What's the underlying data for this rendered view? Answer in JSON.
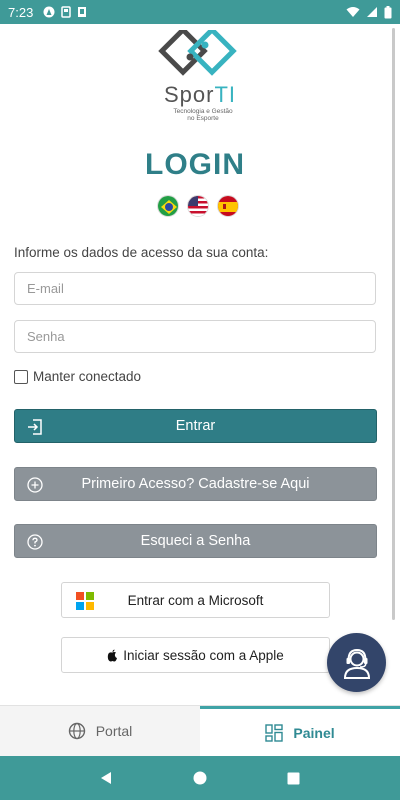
{
  "status_bar": {
    "time": "7:23"
  },
  "logo": {
    "word_main": "Spor",
    "word_accent": "TI",
    "tagline_line1": "Tecnologia e Gestão",
    "tagline_line2": "no Esporte"
  },
  "title": "LOGIN",
  "languages": [
    "brazil-flag",
    "usa-flag",
    "spain-flag"
  ],
  "instruction": "Informe os dados de acesso da sua conta:",
  "form": {
    "email_placeholder": "E-mail",
    "password_placeholder": "Senha",
    "keep_connected_label": "Manter conectado",
    "keep_connected_checked": false
  },
  "buttons": {
    "login": "Entrar",
    "first_access": "Primeiro Acesso? Cadastre-se Aqui",
    "forgot_password": "Esqueci a Senha",
    "microsoft": "Entrar com a Microsoft",
    "apple": "Iniciar sessão com a Apple"
  },
  "tabs": [
    {
      "label": "Portal",
      "icon": "globe-icon",
      "active": false
    },
    {
      "label": "Painel",
      "icon": "dashboard-icon",
      "active": true
    }
  ],
  "colors": {
    "accent": "#3f9a98",
    "primary_button": "#2f7d86",
    "gray_button": "#8c9399",
    "title": "#2f7f88",
    "fab": "#33456a"
  }
}
